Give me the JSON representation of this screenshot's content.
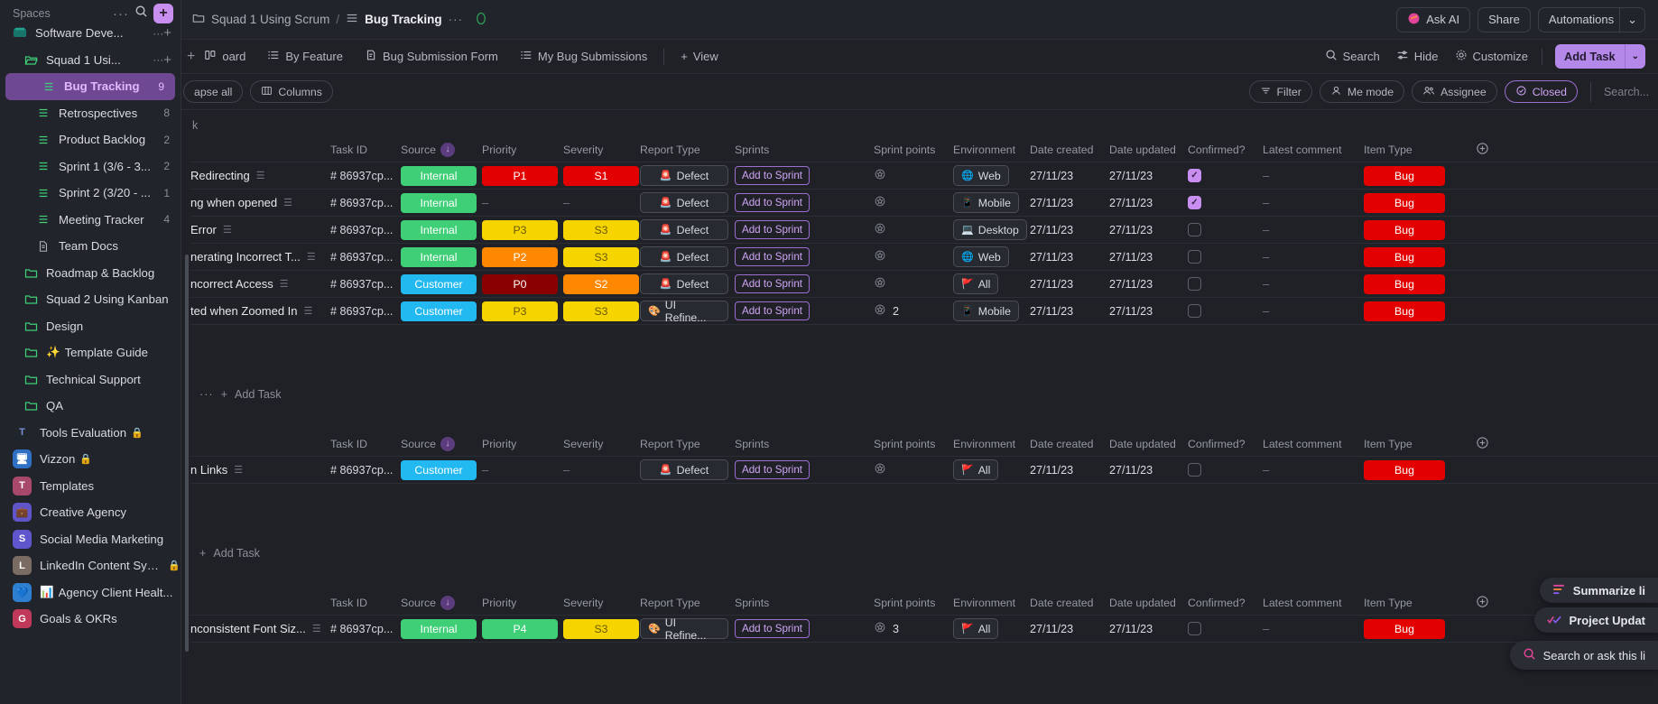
{
  "sidebar": {
    "title": "Spaces",
    "more_icon": "ellipsis-icon",
    "search_icon": "search-icon",
    "add_label": "+",
    "items": [
      {
        "label": "Software Deve...",
        "type": "space",
        "indent": 1,
        "icon": "space-teal-icon",
        "count": "",
        "trailing": "dots-plus",
        "partial": true
      },
      {
        "label": "Squad 1 Usi...",
        "type": "folder",
        "indent": 2,
        "icon": "folder-open-icon",
        "count": "",
        "trailing": "dots-plus"
      },
      {
        "label": "Bug Tracking",
        "type": "list",
        "indent": 3,
        "icon": "list-icon",
        "count": "9",
        "active": true
      },
      {
        "label": "Retrospectives",
        "type": "list",
        "indent": 3,
        "icon": "list-icon",
        "count": "8"
      },
      {
        "label": "Product Backlog",
        "type": "list",
        "indent": 3,
        "icon": "list-icon",
        "count": "2"
      },
      {
        "label": "Sprint 1 (3/6 - 3...",
        "type": "list",
        "indent": 3,
        "icon": "list-icon",
        "count": "2"
      },
      {
        "label": "Sprint 2 (3/20 - ...",
        "type": "list",
        "indent": 3,
        "icon": "list-icon",
        "count": "1"
      },
      {
        "label": "Meeting Tracker",
        "type": "list",
        "indent": 3,
        "icon": "list-icon",
        "count": "4"
      },
      {
        "label": "Team Docs",
        "type": "doc",
        "indent": 3,
        "icon": "doc-icon",
        "count": ""
      },
      {
        "label": "Roadmap & Backlog",
        "type": "folder",
        "indent": 2,
        "icon": "folder-icon",
        "count": ""
      },
      {
        "label": "Squad 2 Using Kanban",
        "type": "folder",
        "indent": 2,
        "icon": "folder-icon",
        "count": ""
      },
      {
        "label": "Design",
        "type": "folder",
        "indent": 2,
        "icon": "folder-icon",
        "count": ""
      },
      {
        "label": "Template Guide",
        "type": "folder",
        "indent": 2,
        "icon": "folder-icon",
        "emoji": "✨",
        "count": ""
      },
      {
        "label": "Technical Support",
        "type": "folder",
        "indent": 2,
        "icon": "folder-icon",
        "count": ""
      },
      {
        "label": "QA",
        "type": "folder",
        "indent": 2,
        "icon": "folder-icon",
        "count": ""
      },
      {
        "label": "Tools Evaluation",
        "type": "space",
        "indent": 1,
        "avatar": "T",
        "avatar_bg": "#20242b",
        "avatar_fg": "#7a8fd8",
        "locked": true,
        "count": ""
      },
      {
        "label": "Vizzon",
        "type": "space",
        "indent": 1,
        "avatar": "🖥",
        "avatar_bg": "#2f6fc4",
        "locked": true,
        "count": ""
      },
      {
        "label": "Templates",
        "type": "space",
        "indent": 1,
        "avatar": "T",
        "avatar_bg": "#a8486b",
        "count": ""
      },
      {
        "label": "Creative Agency",
        "type": "space",
        "indent": 1,
        "avatar": "💼",
        "avatar_bg": "#6055c8",
        "count": ""
      },
      {
        "label": "Social Media Marketing",
        "type": "space",
        "indent": 1,
        "avatar": "S",
        "avatar_bg": "#5f55cc",
        "count": ""
      },
      {
        "label": "LinkedIn Content Syst...",
        "type": "space",
        "indent": 1,
        "avatar": "L",
        "avatar_bg": "#7a6b63",
        "locked": true,
        "count": ""
      },
      {
        "label": "Agency Client Healt...",
        "type": "space",
        "indent": 1,
        "avatar": "💙",
        "avatar_bg": "#2f7fd0",
        "emoji": "📊",
        "count": ""
      },
      {
        "label": "Goals & OKRs",
        "type": "space",
        "indent": 1,
        "avatar": "G",
        "avatar_bg": "#c0395a",
        "count": "",
        "partial": true
      }
    ]
  },
  "topbar": {
    "breadcrumb_folder_icon": "folder-icon",
    "breadcrumb_space": "Squad 1 Using Scrum",
    "breadcrumb_sep": "/",
    "breadcrumb_list_icon": "list-icon",
    "breadcrumb_list": "Bug Tracking",
    "breadcrumb_more": "···",
    "status_icon": "avocado-icon",
    "ask_ai": "Ask AI",
    "share": "Share",
    "automations": "Automations",
    "automations_caret": "⌄"
  },
  "tabs": {
    "items": [
      {
        "label": "oard",
        "icon": "board-icon",
        "truncated": true
      },
      {
        "label": "By Feature",
        "icon": "list-icon"
      },
      {
        "label": "Bug Submission Form",
        "icon": "form-icon"
      },
      {
        "label": "My Bug Submissions",
        "icon": "list-icon"
      }
    ],
    "add_view": "View",
    "add_view_plus": "+",
    "search": "Search",
    "hide": "Hide",
    "customize": "Customize",
    "add_task": "Add Task",
    "add_task_caret": "⌄"
  },
  "filterbar": {
    "collapse_all": "apse all",
    "columns": "Columns",
    "filter": "Filter",
    "me_mode": "Me mode",
    "assignee": "Assignee",
    "closed": "Closed",
    "search_placeholder": "Search..."
  },
  "table": {
    "columns": [
      "Task ID",
      "Source",
      "Priority",
      "Severity",
      "Report Type",
      "Sprints",
      "Sprint points",
      "Environment",
      "Date created",
      "Date updated",
      "Confirmed?",
      "Latest comment",
      "Item Type"
    ],
    "sorted_column": "Source",
    "sort_icon": "sort-down-icon",
    "add_column_icon": "plus-circle-icon",
    "groups": [
      {
        "header_partial": "k",
        "add_task": "Add Task",
        "show_add_task": true,
        "rows": [
          {
            "name": "Redirecting",
            "task_id": "# 86937cp...",
            "source": "Internal",
            "source_color": "#3ecf77",
            "priority": "P1",
            "priority_color": "#e20000",
            "severity": "S1",
            "severity_color": "#e20000",
            "report_type": "Defect",
            "report_icon": "🚨",
            "sprint": "Add to Sprint",
            "sprint_points": "",
            "environment": "Web",
            "env_icon": "🌐",
            "date_created": "27/11/23",
            "date_updated": "27/11/23",
            "confirmed": true,
            "latest_comment": "–",
            "item_type": "Bug",
            "item_color": "#e20000"
          },
          {
            "name": "ng when opened",
            "task_id": "# 86937cp...",
            "source": "Internal",
            "source_color": "#3ecf77",
            "priority": "–",
            "priority_color": "",
            "severity": "–",
            "severity_color": "",
            "report_type": "Defect",
            "report_icon": "🚨",
            "sprint": "Add to Sprint",
            "sprint_points": "",
            "environment": "Mobile",
            "env_icon": "📱",
            "date_created": "27/11/23",
            "date_updated": "27/11/23",
            "confirmed": true,
            "latest_comment": "–",
            "item_type": "Bug",
            "item_color": "#e20000"
          },
          {
            "name": "Error",
            "task_id": "# 86937cp...",
            "source": "Internal",
            "source_color": "#3ecf77",
            "priority": "P3",
            "priority_color": "#f5d400",
            "priority_text": "#6a5a00",
            "severity": "S3",
            "severity_color": "#f5d400",
            "severity_text": "#6a5a00",
            "report_type": "Defect",
            "report_icon": "🚨",
            "sprint": "Add to Sprint",
            "sprint_points": "",
            "environment": "Desktop",
            "env_icon": "💻",
            "date_created": "27/11/23",
            "date_updated": "27/11/23",
            "confirmed": false,
            "latest_comment": "–",
            "item_type": "Bug",
            "item_color": "#e20000"
          },
          {
            "name": "nerating Incorrect T...",
            "task_id": "# 86937cp...",
            "source": "Internal",
            "source_color": "#3ecf77",
            "priority": "P2",
            "priority_color": "#ff8800",
            "severity": "S3",
            "severity_color": "#f5d400",
            "severity_text": "#6a5a00",
            "report_type": "Defect",
            "report_icon": "🚨",
            "sprint": "Add to Sprint",
            "sprint_points": "",
            "environment": "Web",
            "env_icon": "🌐",
            "date_created": "27/11/23",
            "date_updated": "27/11/23",
            "confirmed": false,
            "latest_comment": "–",
            "item_type": "Bug",
            "item_color": "#e20000"
          },
          {
            "name": "ncorrect Access",
            "task_id": "# 86937cp...",
            "source": "Customer",
            "source_color": "#22b8f0",
            "priority": "P0",
            "priority_color": "#8a0000",
            "severity": "S2",
            "severity_color": "#ff8800",
            "report_type": "Defect",
            "report_icon": "🚨",
            "sprint": "Add to Sprint",
            "sprint_points": "",
            "environment": "All",
            "env_icon": "🚩",
            "date_created": "27/11/23",
            "date_updated": "27/11/23",
            "confirmed": false,
            "latest_comment": "–",
            "item_type": "Bug",
            "item_color": "#e20000"
          },
          {
            "name": "ted when Zoomed In",
            "task_id": "# 86937cp...",
            "source": "Customer",
            "source_color": "#22b8f0",
            "priority": "P3",
            "priority_color": "#f5d400",
            "priority_text": "#6a5a00",
            "severity": "S3",
            "severity_color": "#f5d400",
            "severity_text": "#6a5a00",
            "report_type": "UI Refine...",
            "report_icon": "🎨",
            "sprint": "Add to Sprint",
            "sprint_points": "2",
            "environment": "Mobile",
            "env_icon": "📱",
            "date_created": "27/11/23",
            "date_updated": "27/11/23",
            "confirmed": false,
            "latest_comment": "–",
            "item_type": "Bug",
            "item_color": "#e20000"
          }
        ]
      },
      {
        "header_partial": "",
        "add_task": "Add Task",
        "show_add_task": true,
        "rows": [
          {
            "name": "n Links",
            "task_id": "# 86937cp...",
            "source": "Customer",
            "source_color": "#22b8f0",
            "priority": "–",
            "priority_color": "",
            "severity": "–",
            "severity_color": "",
            "report_type": "Defect",
            "report_icon": "🚨",
            "sprint": "Add to Sprint",
            "sprint_points": "",
            "environment": "All",
            "env_icon": "🚩",
            "date_created": "27/11/23",
            "date_updated": "27/11/23",
            "confirmed": false,
            "latest_comment": "–",
            "item_type": "Bug",
            "item_color": "#e20000"
          }
        ]
      },
      {
        "header_partial": "",
        "add_task": "",
        "show_add_task": false,
        "rows": [
          {
            "name": "nconsistent Font Siz...",
            "task_id": "# 86937cp...",
            "source": "Internal",
            "source_color": "#3ecf77",
            "priority": "P4",
            "priority_color": "#3ecf77",
            "severity": "S3",
            "severity_color": "#f5d400",
            "severity_text": "#6a5a00",
            "report_type": "UI Refine...",
            "report_icon": "🎨",
            "sprint": "Add to Sprint",
            "sprint_points": "3",
            "environment": "All",
            "env_icon": "🚩",
            "date_created": "27/11/23",
            "date_updated": "27/11/23",
            "confirmed": false,
            "latest_comment": "–",
            "item_type": "Bug",
            "item_color": "#e20000"
          }
        ]
      }
    ]
  },
  "floating": {
    "summarize": "Summarize li",
    "summarize_icon": "summarize-icon",
    "project_update": "Project Updat",
    "project_icon": "project-update-icon",
    "search_ask": "Search or ask this li",
    "search_icon": "search-ai-icon"
  }
}
